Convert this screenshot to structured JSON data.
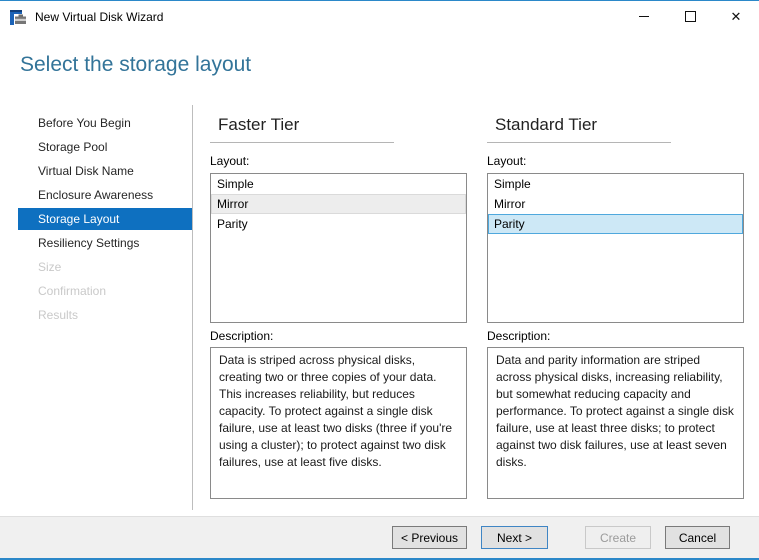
{
  "window": {
    "title": "New Virtual Disk Wizard",
    "accent_border_color": "#2b88c9",
    "controls": {
      "minimize_icon": "minimize",
      "maximize_icon": "maximize",
      "close_icon": "close",
      "close_glyph": "✕"
    }
  },
  "header": {
    "title": "Select the storage layout",
    "color": "#337499"
  },
  "sidebar": {
    "selected_bg": "#0e70c0",
    "items": [
      {
        "label": "Before You Begin",
        "state": "enabled"
      },
      {
        "label": "Storage Pool",
        "state": "enabled"
      },
      {
        "label": "Virtual Disk Name",
        "state": "enabled"
      },
      {
        "label": "Enclosure Awareness",
        "state": "enabled"
      },
      {
        "label": "Storage Layout",
        "state": "selected"
      },
      {
        "label": "Resiliency Settings",
        "state": "enabled"
      },
      {
        "label": "Size",
        "state": "disabled"
      },
      {
        "label": "Confirmation",
        "state": "disabled"
      },
      {
        "label": "Results",
        "state": "disabled"
      }
    ]
  },
  "tiers": [
    {
      "title": "Faster Tier",
      "layout_label": "Layout:",
      "options": [
        {
          "label": "Simple",
          "state": "none"
        },
        {
          "label": "Mirror",
          "state": "selected-inactive"
        },
        {
          "label": "Parity",
          "state": "none"
        }
      ],
      "selection_inactive_bg": "#ededed",
      "description_label": "Description:",
      "description": "Data is striped across physical disks, creating two or three copies of your data. This increases reliability, but reduces capacity. To protect against a single disk failure, use at least two disks (three if you're using a cluster); to protect against two disk failures, use at least five disks."
    },
    {
      "title": "Standard Tier",
      "layout_label": "Layout:",
      "options": [
        {
          "label": "Simple",
          "state": "none"
        },
        {
          "label": "Mirror",
          "state": "none"
        },
        {
          "label": "Parity",
          "state": "selected-active"
        }
      ],
      "selection_active_bg": "#cde8f6",
      "description_label": "Description:",
      "description": "Data and parity information are striped across physical disks, increasing reliability, but somewhat reducing capacity and performance. To protect against a single disk failure, use at least three disks; to protect against two disk failures, use at least seven disks."
    }
  ],
  "footer": {
    "buttons": [
      {
        "label": "< Previous",
        "state": "normal"
      },
      {
        "label": "Next >",
        "state": "default"
      },
      {
        "label": "Create",
        "state": "disabled"
      },
      {
        "label": "Cancel",
        "state": "normal"
      }
    ]
  }
}
